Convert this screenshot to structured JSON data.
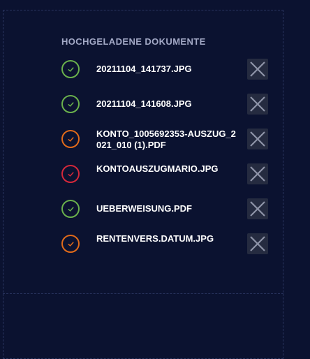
{
  "upload": {
    "title": "HOCHGELADENE DOKUMENTE",
    "files": [
      {
        "name": "20211104_141737.JPG",
        "status": "green"
      },
      {
        "name": "20211104_141608.JPG",
        "status": "green"
      },
      {
        "name": "KONTO_1005692353-AUSZUG_2021_010 (1).PDF",
        "status": "orange"
      },
      {
        "name": "KONTOAUSZUGMARIO.JPG",
        "status": "red"
      },
      {
        "name": "UEBERWEISUNG.PDF",
        "status": "green"
      },
      {
        "name": "RENTENVERS.DATUM.JPG",
        "status": "orange"
      }
    ]
  },
  "colors": {
    "background": "#0b1230",
    "green": "#6ab04c",
    "orange": "#e06a1a",
    "red": "#d4283a",
    "remove_button_bg": "#252b40",
    "remove_icon": "#8e93a8"
  }
}
